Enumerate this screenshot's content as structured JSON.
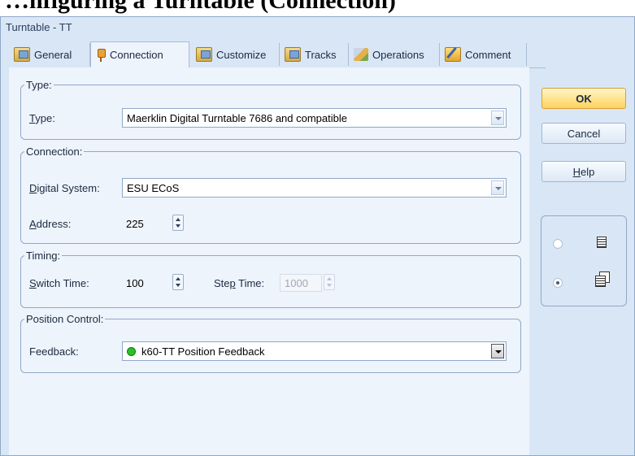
{
  "heading": "…nfiguring a Turntable (Connection)",
  "window": {
    "title": "Turntable - TT"
  },
  "tabs": [
    {
      "label": "General",
      "icon": "general-icon"
    },
    {
      "label": "Connection",
      "icon": "plug-icon"
    },
    {
      "label": "Customize",
      "icon": "customize-icon"
    },
    {
      "label": "Tracks",
      "icon": "tracks-icon"
    },
    {
      "label": "Operations",
      "icon": "operations-icon"
    },
    {
      "label": "Comment",
      "icon": "comment-icon"
    }
  ],
  "type_group": {
    "legend": "Type:",
    "type_label_u": "T",
    "type_label_rest": "ype:",
    "type_value": "Maerklin Digital Turntable 7686 and compatible"
  },
  "connection_group": {
    "legend": "Connection:",
    "system_label_u": "D",
    "system_label_rest": "igital System:",
    "system_value": "ESU ECoS",
    "address_label_u": "A",
    "address_label_rest": "ddress:",
    "address_value": "225"
  },
  "timing_group": {
    "legend": "Timing:",
    "switch_label_u": "S",
    "switch_label_rest": "witch Time:",
    "switch_value": "100",
    "step_label_pre": "Ste",
    "step_label_u": "p",
    "step_label_rest": " Time:",
    "step_value": "1000"
  },
  "position_group": {
    "legend": "Position Control:",
    "feedback_label": "Feedback:",
    "feedback_value": "k60-TT Position Feedback",
    "feedback_status_color": "#27c22a"
  },
  "buttons": {
    "ok": "OK",
    "cancel": "Cancel",
    "help_u": "H",
    "help_rest": "elp"
  },
  "view_options": {
    "selected": "pages-view"
  }
}
